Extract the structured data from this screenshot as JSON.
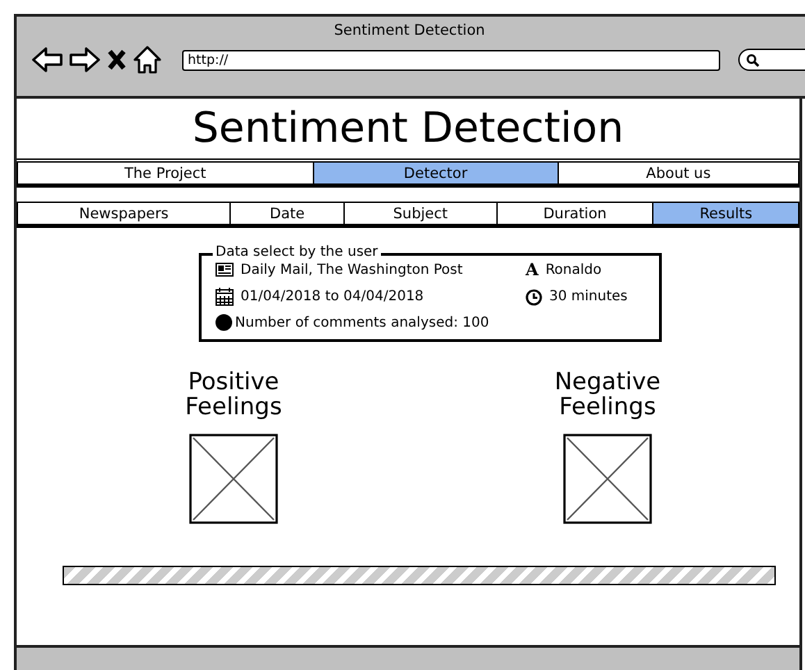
{
  "window": {
    "title": "Sentiment Detection",
    "address": "http://"
  },
  "page_title": "Sentiment Detection",
  "main_tabs": [
    {
      "label": "The Project",
      "selected": false
    },
    {
      "label": "Detector",
      "selected": true
    },
    {
      "label": "About us",
      "selected": false
    }
  ],
  "step_tabs": [
    {
      "label": "Newspapers",
      "selected": false
    },
    {
      "label": "Date",
      "selected": false
    },
    {
      "label": "Subject",
      "selected": false
    },
    {
      "label": "Duration",
      "selected": false
    },
    {
      "label": "Results",
      "selected": true
    }
  ],
  "selection": {
    "legend": "Data select by the user",
    "items": [
      {
        "kind": "newspapers",
        "text": "Daily Mail, The Washington Post"
      },
      {
        "kind": "subject",
        "icon": "A",
        "text": "Ronaldo"
      },
      {
        "kind": "dates",
        "text": "01/04/2018 to 04/04/2018"
      },
      {
        "kind": "duration",
        "text": "30 minutes"
      },
      {
        "kind": "comments",
        "text": "Number of comments analysed: 100"
      }
    ]
  },
  "feelings": [
    {
      "title": "Positive Feelings"
    },
    {
      "title": "Negative Feelings"
    }
  ],
  "progress": {
    "indeterminate": true
  }
}
